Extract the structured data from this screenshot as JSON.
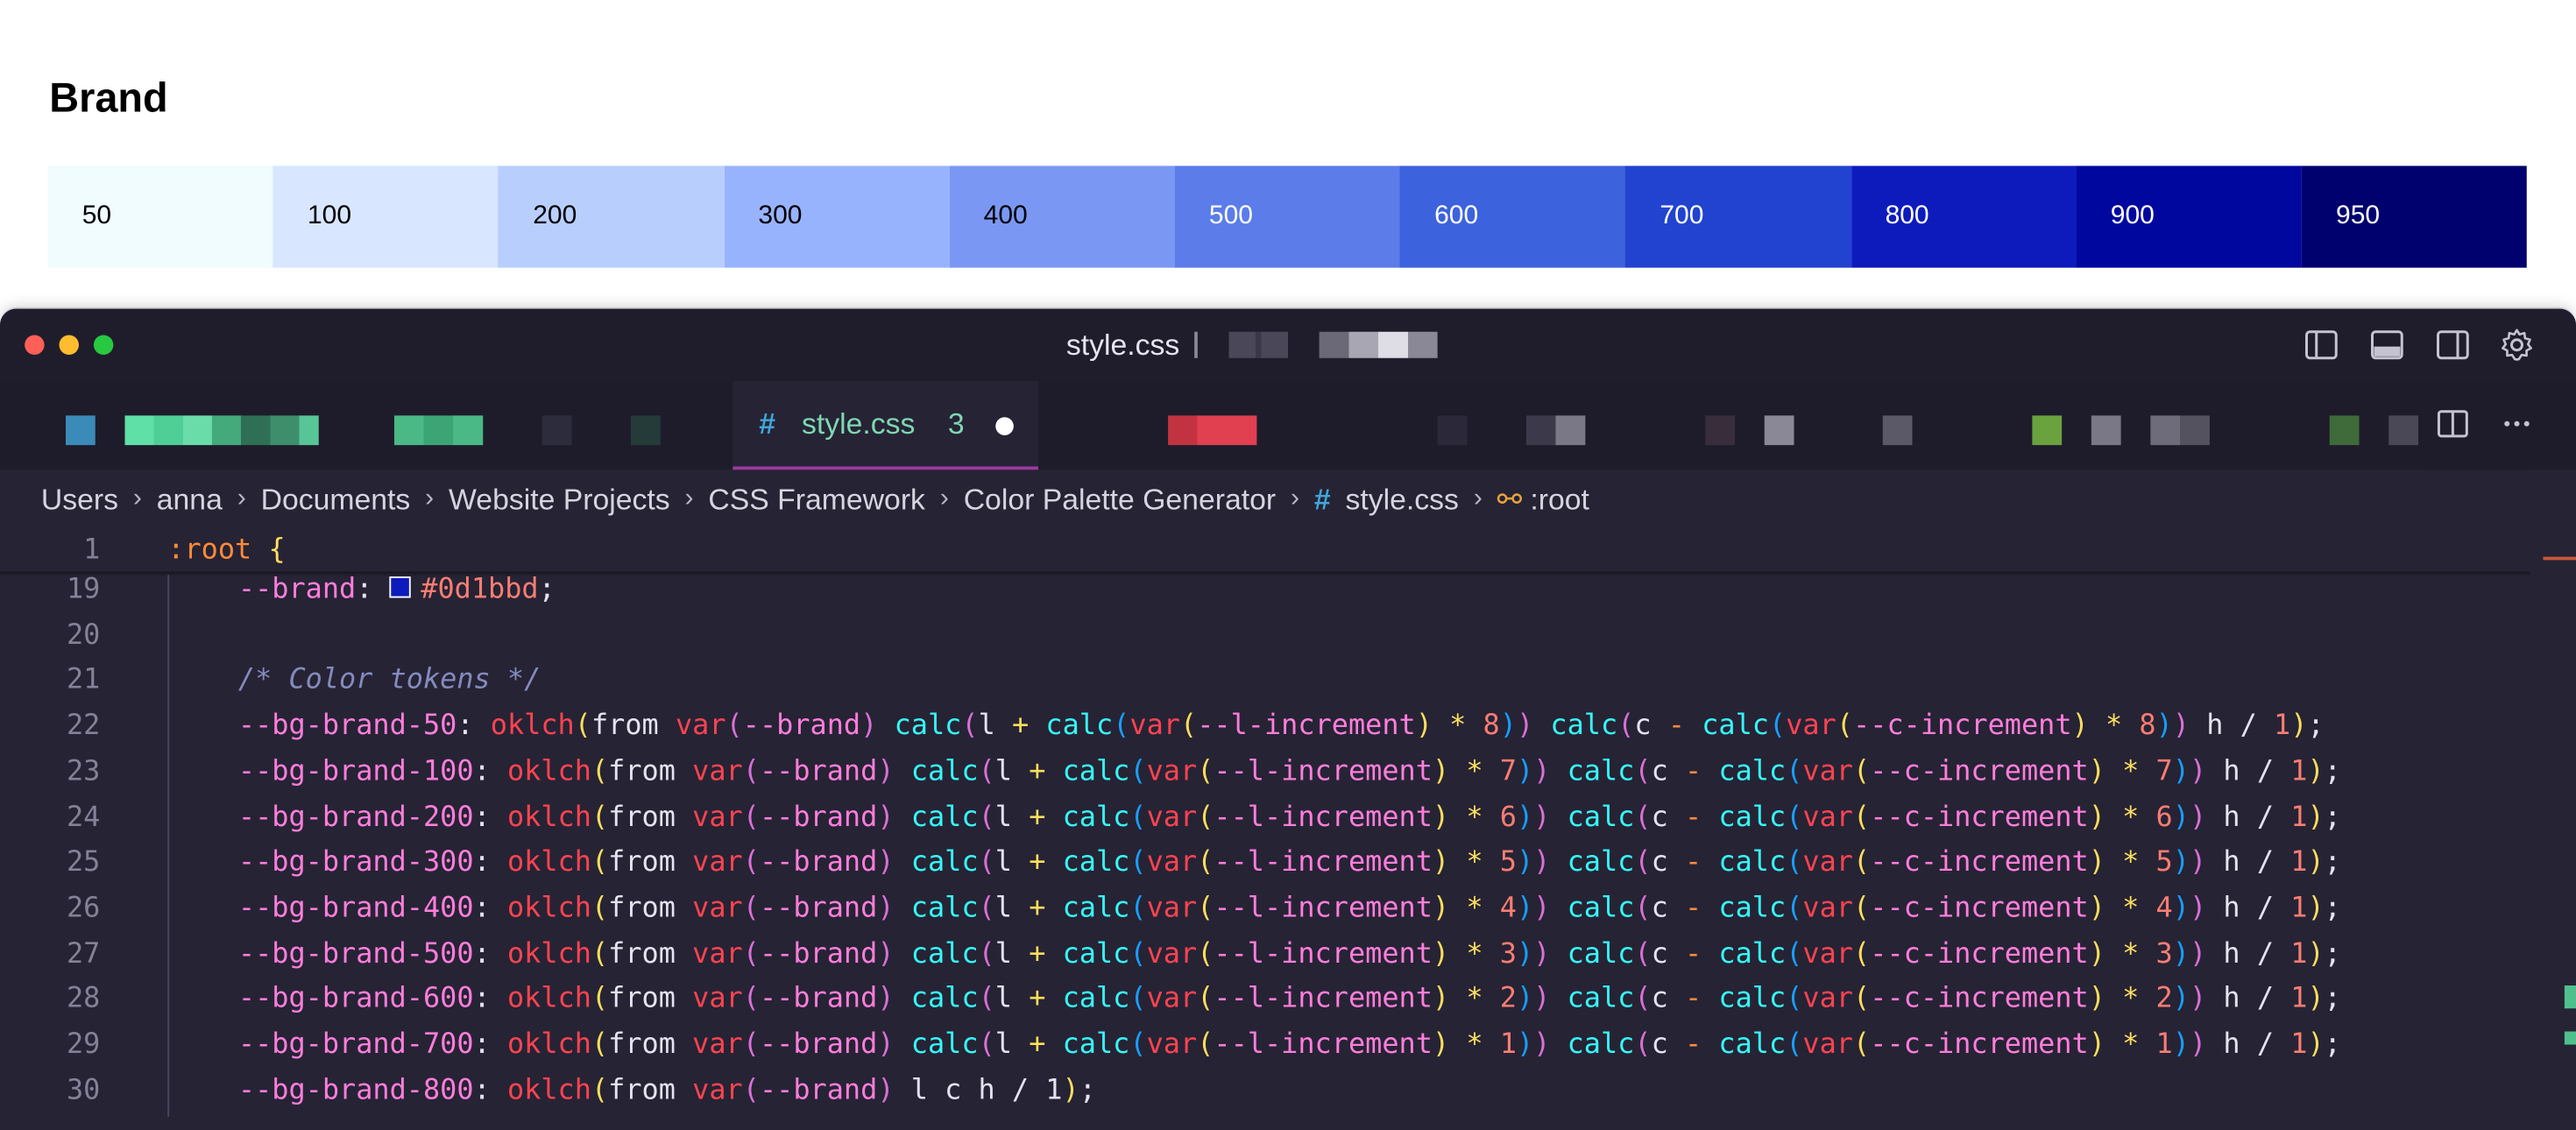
{
  "brand": {
    "title": "Brand",
    "swatches": [
      {
        "label": "50",
        "bg": "#f1fcff",
        "fg": "#000000"
      },
      {
        "label": "100",
        "bg": "#d8e7ff",
        "fg": "#000000"
      },
      {
        "label": "200",
        "bg": "#b8cffe",
        "fg": "#000000"
      },
      {
        "label": "300",
        "bg": "#98b3fd",
        "fg": "#000000"
      },
      {
        "label": "400",
        "bg": "#7a98f3",
        "fg": "#000000"
      },
      {
        "label": "500",
        "bg": "#5b7ce9",
        "fg": "#ffffff"
      },
      {
        "label": "600",
        "bg": "#3c62dd",
        "fg": "#ffffff"
      },
      {
        "label": "700",
        "bg": "#2143cf",
        "fg": "#ffffff"
      },
      {
        "label": "800",
        "bg": "#0d1bbd",
        "fg": "#ffffff"
      },
      {
        "label": "900",
        "bg": "#00079e",
        "fg": "#ffffff"
      },
      {
        "label": "950",
        "bg": "#00006f",
        "fg": "#ffffff"
      }
    ]
  },
  "window": {
    "title": "style.css",
    "traffic_colors": {
      "close": "#fe5f57",
      "minimize": "#febc2e",
      "maximize": "#28c840"
    },
    "icons": [
      "toggle-primary-sidebar-icon",
      "toggle-panel-icon",
      "toggle-secondary-sidebar-icon",
      "settings-gear-icon"
    ]
  },
  "tabs": {
    "active": {
      "label": "style.css",
      "problems": "3",
      "hash": "#"
    },
    "actions": [
      "split-editor-icon",
      "more-actions-icon"
    ]
  },
  "breadcrumb": {
    "items": [
      "Users",
      "anna",
      "Documents",
      "Website Projects",
      "CSS Framework",
      "Color Palette Generator"
    ],
    "file_hash": "#",
    "file": "style.css",
    "symbol_icon": "⚯",
    "symbol": ":root"
  },
  "editor": {
    "sticky_line": {
      "num": "1",
      "selector": ":root",
      "brace": "{"
    },
    "line19": {
      "num": "19",
      "prop": "--brand",
      "value": "#0d1bbd",
      "swatch": "#0d1bbd"
    },
    "line20": {
      "num": "20"
    },
    "line21": {
      "num": "21",
      "comment": "/* Color tokens */"
    },
    "tokens": [
      {
        "num": "22",
        "prop": "--bg-brand-50",
        "mult": "8"
      },
      {
        "num": "23",
        "prop": "--bg-brand-100",
        "mult": "7"
      },
      {
        "num": "24",
        "prop": "--bg-brand-200",
        "mult": "6"
      },
      {
        "num": "25",
        "prop": "--bg-brand-300",
        "mult": "5"
      },
      {
        "num": "26",
        "prop": "--bg-brand-400",
        "mult": "4"
      },
      {
        "num": "27",
        "prop": "--bg-brand-500",
        "mult": "3"
      },
      {
        "num": "28",
        "prop": "--bg-brand-600",
        "mult": "2"
      },
      {
        "num": "29",
        "prop": "--bg-brand-700",
        "mult": "1"
      }
    ],
    "line30": {
      "num": "30",
      "prop": "--bg-brand-800",
      "tail": "l c h / 1"
    },
    "fn": "oklch",
    "from_kw": "from",
    "var_fn": "var",
    "brand_var": "--brand",
    "calc_fn": "calc",
    "l_ch": "l",
    "c_ch": "c",
    "h_ch": "h",
    "l_inc": "--l-increment",
    "c_inc": "--c-increment",
    "alpha": "1"
  }
}
